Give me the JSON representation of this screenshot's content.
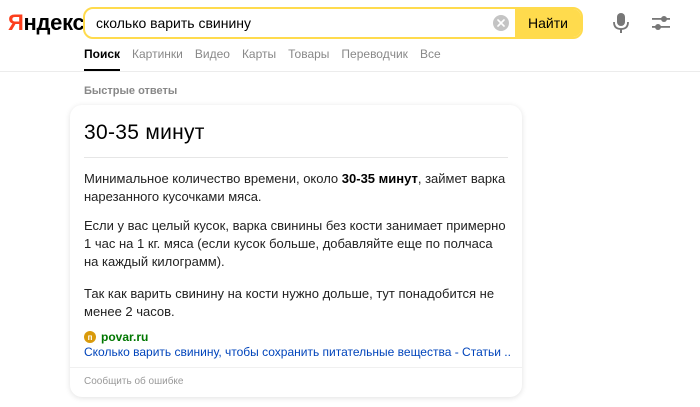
{
  "header": {
    "logo_first": "Я",
    "logo_rest": "ндекс",
    "search": {
      "value": "сколько варить свинину",
      "placeholder": ""
    },
    "search_button": "Найти",
    "icons": {
      "clear": "clear-icon",
      "mic": "microphone-icon",
      "settings": "settings-sliders-icon"
    }
  },
  "tabs": [
    {
      "label": "Поиск",
      "active": true
    },
    {
      "label": "Картинки"
    },
    {
      "label": "Видео"
    },
    {
      "label": "Карты"
    },
    {
      "label": "Товары"
    },
    {
      "label": "Переводчик"
    },
    {
      "label": "Все"
    }
  ],
  "quick_answers": {
    "section_title": "Быстрые ответы",
    "answer_title": "30-35 минут",
    "paragraph1_pre": "Минимальное количество времени, около ",
    "paragraph1_bold": "30-35 минут",
    "paragraph1_post": ", займет варка нарезанного кусочками мяса.",
    "paragraph2": "Если у вас целый кусок, варка свинины без кости занимает примерно 1 час на 1 кг. мяса (если кусок больше, добавляйте еще по полчаса на каждый килограмм).",
    "paragraph3": "Так как варить свинину на кости нужно дольше, тут понадобится не менее 2 часов.",
    "source": {
      "favicon_letter": "п",
      "domain": "povar.ru",
      "link": "Сколько варить свинину, чтобы сохранить питательные вещества - Статьи ..."
    },
    "report_label": "Сообщить об ошибке"
  },
  "colors": {
    "brand_red": "#fc3f1d",
    "accent_yellow": "#ffdb4d",
    "link_blue": "#04b",
    "domain_green": "#007700"
  }
}
